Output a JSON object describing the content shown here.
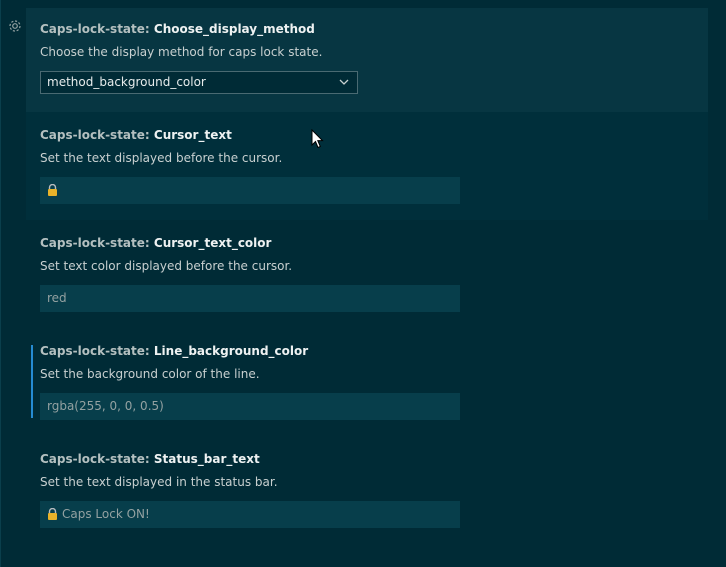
{
  "settings": [
    {
      "category": "Caps-lock-state:",
      "key": "Choose_display_method",
      "description": "Choose the display method for caps lock state.",
      "control": "select",
      "value": "method_background_color"
    },
    {
      "category": "Caps-lock-state:",
      "key": "Cursor_text",
      "description": "Set the text displayed before the cursor.",
      "control": "text",
      "value": ""
    },
    {
      "category": "Caps-lock-state:",
      "key": "Cursor_text_color",
      "description": "Set text color displayed before the cursor.",
      "control": "text",
      "value": "red"
    },
    {
      "category": "Caps-lock-state:",
      "key": "Line_background_color",
      "description": "Set the background color of the line.",
      "control": "text",
      "value": "rgba(255, 0, 0, 0.5)"
    },
    {
      "category": "Caps-lock-state:",
      "key": "Status_bar_text",
      "description": "Set the text displayed in the status bar.",
      "control": "text",
      "value": "Caps Lock ON!"
    }
  ],
  "icons": {
    "gear": "gear-icon",
    "lock": "lock-icon",
    "chevron": "chevron-down-icon"
  },
  "colors": {
    "background": "#002b36",
    "focused_row": "#073642",
    "modified_indicator": "#268bd2",
    "lock_body": "#e8b32a"
  }
}
